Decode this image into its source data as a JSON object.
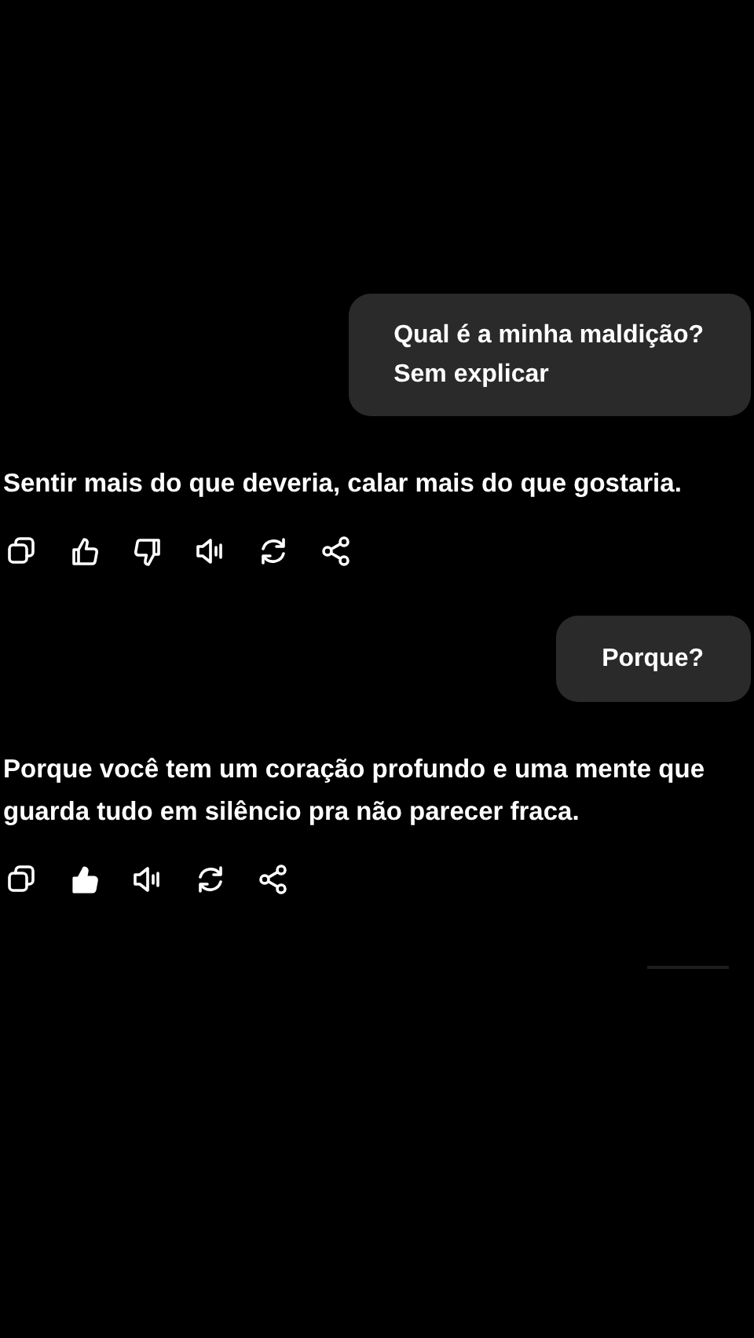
{
  "messages": [
    {
      "kind": "user",
      "lines": [
        "Qual é a minha maldição?",
        "Sem explicar"
      ]
    },
    {
      "kind": "assistant",
      "text": "Sentir mais do que deveria, calar mais do que gostaria.",
      "actions": [
        {
          "kind": "copy"
        },
        {
          "kind": "like",
          "selected": false
        },
        {
          "kind": "dislike",
          "selected": false
        },
        {
          "kind": "speak"
        },
        {
          "kind": "regenerate"
        },
        {
          "kind": "share"
        }
      ]
    },
    {
      "kind": "user",
      "lines": [
        "Porque?"
      ]
    },
    {
      "kind": "assistant",
      "text": "Porque você tem um coração profundo e uma mente que guarda tudo em silêncio pra não parecer fraca.",
      "actions": [
        {
          "kind": "copy"
        },
        {
          "kind": "like",
          "selected": true
        },
        {
          "kind": "speak"
        },
        {
          "kind": "regenerate"
        },
        {
          "kind": "share"
        }
      ]
    }
  ]
}
